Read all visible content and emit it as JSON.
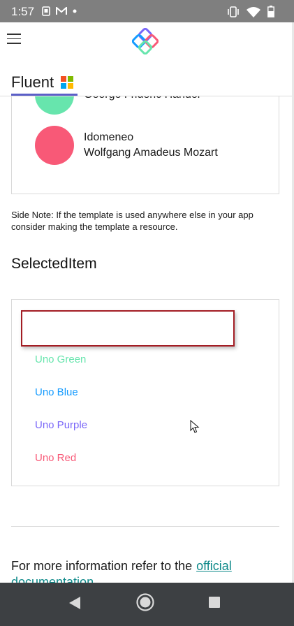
{
  "status_bar": {
    "time": "1:57",
    "left_icons": [
      "screenshot-icon",
      "gmail-icon",
      "notification-dot-icon"
    ],
    "right_icons": [
      "vibrate-icon",
      "wifi-icon",
      "battery-icon"
    ]
  },
  "app_bar": {
    "menu_icon": "hamburger-icon",
    "logo_icon": "uno-logo-icon"
  },
  "tabs": {
    "active_label": "Fluent",
    "active_icon": "microsoft-logo-icon",
    "indicator_color": "#5b5fc7"
  },
  "people_list": [
    {
      "line1": "",
      "line2": "George Frideric Handel",
      "avatar_color": "#67e5ad"
    },
    {
      "line1": "Idomeneo",
      "line2": "Wolfgang Amadeus Mozart",
      "avatar_color": "#f85977"
    }
  ],
  "side_note": "Side Note: If the template is used anywhere else in your app consider making the template a resource.",
  "selected_item": {
    "title": "SelectedItem",
    "selected_value": "",
    "options": [
      {
        "label": "Uno Green",
        "color": "#67e5ad"
      },
      {
        "label": "Uno Blue",
        "color": "#159bff"
      },
      {
        "label": "Uno Purple",
        "color": "#7a67f8"
      },
      {
        "label": "Uno Red",
        "color": "#f85977"
      }
    ]
  },
  "footer_info": {
    "text": "For more information refer to the",
    "link_text": "official documentation"
  },
  "nav_bar": {
    "back_icon": "back-triangle-icon",
    "home_icon": "home-circle-icon",
    "recent_icon": "recent-apps-square-icon"
  }
}
